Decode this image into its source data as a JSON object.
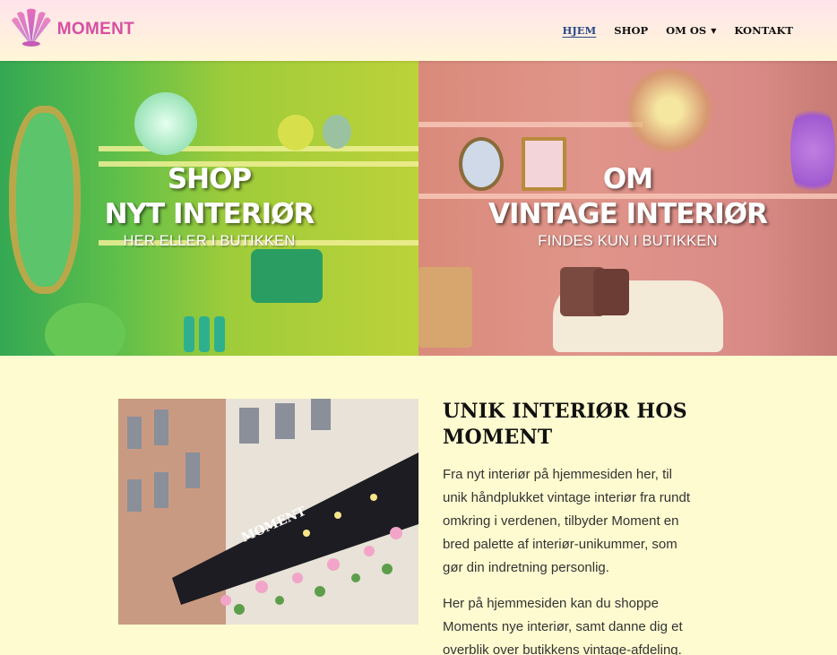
{
  "header": {
    "logo_text": "MOMENT",
    "brand_color": "#d64fa3",
    "nav": [
      {
        "label": "HJEM",
        "active": true
      },
      {
        "label": "SHOP",
        "active": false
      },
      {
        "label": "OM OS",
        "active": false,
        "dropdown": true
      },
      {
        "label": "KONTAKT",
        "active": false
      }
    ]
  },
  "hero": {
    "left": {
      "title_line1": "SHOP",
      "title_line2": "NYT INTERIØR",
      "subtitle": "HER ELLER I BUTIKKEN"
    },
    "right": {
      "title_line1": "OM",
      "title_line2": "VINTAGE INTERIØR",
      "subtitle": "FINDES KUN I BUTIKKEN"
    }
  },
  "storefront_sign": "MOMENT",
  "about": {
    "title": "UNIK INTERIØR HOS MOMENT",
    "paragraph1": "Fra nyt interiør på hjemmesiden her, til unik håndplukket vintage interiør fra rundt omkring i verdenen, tilbyder Moment en bred palette af interiør-unikummer, som gør din indretning personlig.",
    "paragraph2": "Her på hjemmesiden kan du shoppe Moments nye interiør, samt danne dig et overblik over butikkens vintage-afdeling."
  }
}
